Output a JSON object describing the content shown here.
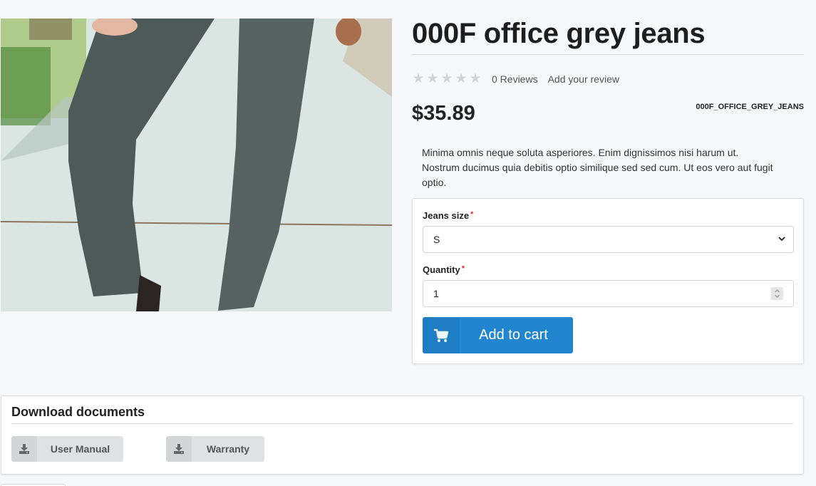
{
  "product": {
    "title": "000F office grey jeans",
    "rating": {
      "value": 0,
      "max": 5,
      "reviews_label": "0 Reviews",
      "add_review_label": "Add your review"
    },
    "price": "$35.89",
    "sku": "000F_OFFICE_GREY_JEANS",
    "description": "Minima omnis neque soluta asperiores. Enim dignissimos nisi harum ut. Nostrum ducimus quia debitis optio similique sed sed cum. Ut eos vero aut fugit optio.",
    "image_alt": "Person wearing grey jeans walking on sidewalk"
  },
  "form": {
    "size_label": "Jeans size",
    "size_required": "*",
    "size_value": "S",
    "quantity_label": "Quantity",
    "quantity_required": "*",
    "quantity_value": "1",
    "add_to_cart_label": "Add to cart"
  },
  "documents": {
    "title": "Download documents",
    "items": [
      {
        "label": "User Manual",
        "icon": "download-icon"
      },
      {
        "label": "Warranty",
        "icon": "download-icon"
      }
    ]
  },
  "colors": {
    "primary": "#2185d0",
    "star_empty": "#d3d3d3",
    "required": "#e03030"
  }
}
